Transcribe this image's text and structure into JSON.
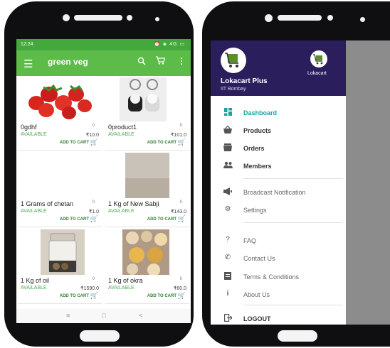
{
  "left_app": {
    "status": {
      "time": "12:24",
      "icons": "⏰ ◈ 4G ▭"
    },
    "appbar": {
      "title": "green veg"
    },
    "products": [
      {
        "name": "0gdhf",
        "count": "0",
        "availability": "AVAILABLE",
        "price": "₹10.0",
        "add_label": "ADD TO CART"
      },
      {
        "name": "0product1",
        "count": "0",
        "availability": "AVAILABLE",
        "price": "₹101.0",
        "add_label": "ADD TO CART"
      },
      {
        "name": "1 Grams of chetan",
        "count": "0",
        "availability": "AVAILABLE",
        "price": "₹1.0",
        "add_label": "ADD TO CART"
      },
      {
        "name": "1 Kg of New Sabji",
        "count": "0",
        "availability": "AVAILABLE",
        "price": "₹143.0",
        "add_label": "ADD TO CART"
      },
      {
        "name": "1 Kg of oil",
        "count": "0",
        "availability": "AVAILABLE",
        "price": "₹1590.0",
        "add_label": "ADD TO CART"
      },
      {
        "name": "1 Kg of okra",
        "count": "0",
        "availability": "AVAILABLE",
        "price": "₹60.0",
        "add_label": "ADD TO CART"
      }
    ],
    "navbar": {
      "left": "≡",
      "center": "□",
      "right": "<"
    }
  },
  "right_app": {
    "header": {
      "org_name": "Lokacart Plus",
      "org_sub": "IIT Bombay",
      "alt_label": "Lokacart"
    },
    "menu": [
      {
        "label": "Dashboard",
        "icon": "dashboard-icon"
      },
      {
        "label": "Products",
        "icon": "basket-icon"
      },
      {
        "label": "Orders",
        "icon": "orders-icon"
      },
      {
        "label": "Members",
        "icon": "members-icon"
      },
      {
        "label": "Broadcast Notification",
        "icon": "megaphone-icon"
      },
      {
        "label": "Settings",
        "icon": "gear-icon"
      },
      {
        "label": "FAQ",
        "icon": "question-icon"
      },
      {
        "label": "Contact Us",
        "icon": "phone-icon"
      },
      {
        "label": "Terms & Conditions",
        "icon": "document-icon"
      },
      {
        "label": "About Us",
        "icon": "info-icon"
      },
      {
        "label": "LOGOUT",
        "icon": "logout-icon"
      }
    ]
  },
  "colors": {
    "status_green": "#43a93b",
    "appbar_green": "#5cbb49",
    "drawer_header": "#2a1f5c",
    "active_teal": "#1aa3a3"
  }
}
